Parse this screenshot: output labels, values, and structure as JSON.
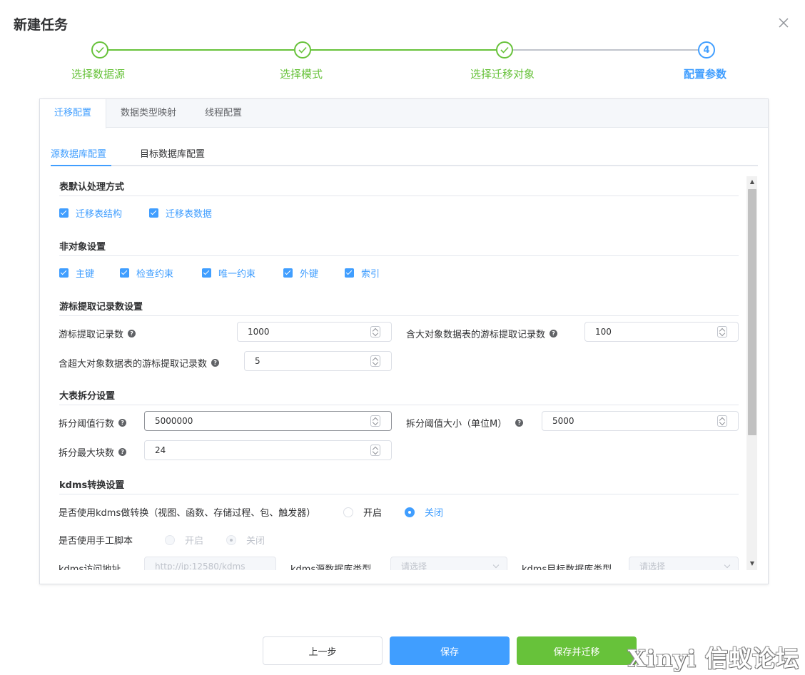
{
  "dialog": {
    "title": "新建任务"
  },
  "steps": [
    {
      "label": "选择数据源",
      "status": "done"
    },
    {
      "label": "选择模式",
      "status": "done"
    },
    {
      "label": "选择迁移对象",
      "status": "done"
    },
    {
      "label": "配置参数",
      "status": "active",
      "number": "4"
    }
  ],
  "tabs": [
    "迁移配置",
    "数据类型映射",
    "线程配置"
  ],
  "subtabs": [
    "源数据库配置",
    "目标数据库配置"
  ],
  "sections": {
    "table_default": {
      "title": "表默认处理方式",
      "checks": [
        "迁移表结构",
        "迁移表数据"
      ]
    },
    "non_object": {
      "title": "非对象设置",
      "checks": [
        "主键",
        "检查约束",
        "唯一约束",
        "外键",
        "索引"
      ]
    },
    "cursor": {
      "title": "游标提取记录数设置",
      "fetch_label": "游标提取记录数",
      "fetch_value": "1000",
      "lob_label": "含大对象数据表的游标提取记录数",
      "lob_value": "100",
      "super_lob_label": "含超大对象数据表的游标提取记录数",
      "super_lob_value": "5"
    },
    "split": {
      "title": "大表拆分设置",
      "rows_label": "拆分阈值行数",
      "rows_value": "5000000",
      "size_label": "拆分阈值大小（单位M）",
      "size_value": "5000",
      "blocks_label": "拆分最大块数",
      "blocks_value": "24"
    },
    "kdms": {
      "title": "kdms转换设置",
      "use_label": "是否使用kdms做转换（视图、函数、存储过程、包、触发器）",
      "on_label": "开启",
      "off_label": "关闭",
      "manual_label": "是否使用手工脚本",
      "manual_on": "开启",
      "manual_off": "关闭",
      "addr_label": "kdms访问地址",
      "addr_placeholder": "http://ip:12580/kdms",
      "src_type_label": "kdms源数据库类型",
      "src_placeholder": "请选择",
      "dst_type_label": "kdms目标数据库类型",
      "dst_placeholder": "请选择"
    }
  },
  "footer": {
    "prev": "上一步",
    "save": "保存",
    "save_migrate": "保存并迁移"
  },
  "watermark": "Xinyi 信蚁论坛",
  "colors": {
    "primary": "#409eff",
    "success": "#67c23a"
  }
}
